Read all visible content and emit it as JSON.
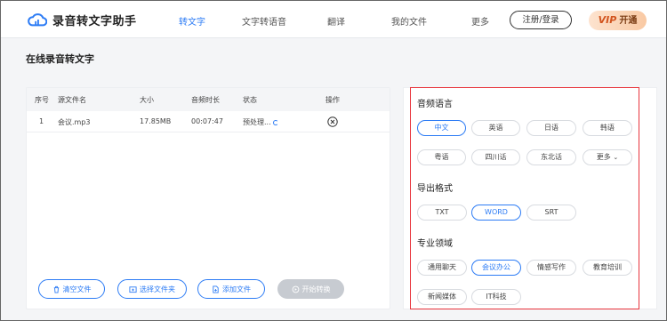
{
  "app": {
    "name": "录音转文字助手"
  },
  "nav": {
    "items": [
      "转文字",
      "文字转语音",
      "翻译",
      "我的文件",
      "更多"
    ],
    "login": "注册/登录",
    "vip_badge": "VIP",
    "vip_label": "开通"
  },
  "page": {
    "title": "在线录音转文字"
  },
  "table": {
    "headers": [
      "序号",
      "源文件名",
      "大小",
      "音频时长",
      "状态",
      "操作"
    ],
    "row": {
      "index": "1",
      "filename": "会议.mp3",
      "size": "17.85MB",
      "duration": "00:07:47",
      "status": "预处理..."
    }
  },
  "actions": {
    "clear": "清空文件",
    "choose_folder": "选择文件夹",
    "add_file": "添加文件",
    "start": "开始转换"
  },
  "settings": {
    "language_title": "音频语言",
    "languages": [
      "中文",
      "英语",
      "日语",
      "韩语",
      "粤语",
      "四川话",
      "东北话",
      "更多"
    ],
    "selected_language": "中文",
    "format_title": "导出格式",
    "formats": [
      "TXT",
      "WORD",
      "SRT"
    ],
    "selected_format": "WORD",
    "domain_title": "专业领域",
    "domains": [
      "通用聊天",
      "会议办公",
      "情感写作",
      "教育培训",
      "新闻媒体",
      "IT科技"
    ],
    "selected_domain": "会议办公"
  },
  "colors": {
    "accent": "#2d7cf5",
    "highlight_border": "#e8343c"
  }
}
